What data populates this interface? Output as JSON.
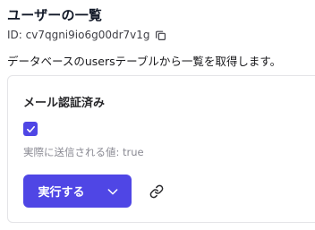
{
  "page": {
    "title": "ユーザーの一覧",
    "id_label": "ID: cv7qgni9io6g00dr7v1g",
    "description": "データベースのusersテーブルから一覧を取得します。"
  },
  "form": {
    "field_label": "メール認証済み",
    "checkbox_checked": true,
    "hint": "実際に送信される値: true"
  },
  "actions": {
    "run_label": "実行する"
  },
  "icons": {
    "copy": "copy-icon",
    "check": "check-icon",
    "chevron": "chevron-down-icon",
    "link": "link-icon"
  },
  "colors": {
    "accent": "#4f46e5",
    "hint": "#8a8a93",
    "border": "#e4e4e7"
  }
}
